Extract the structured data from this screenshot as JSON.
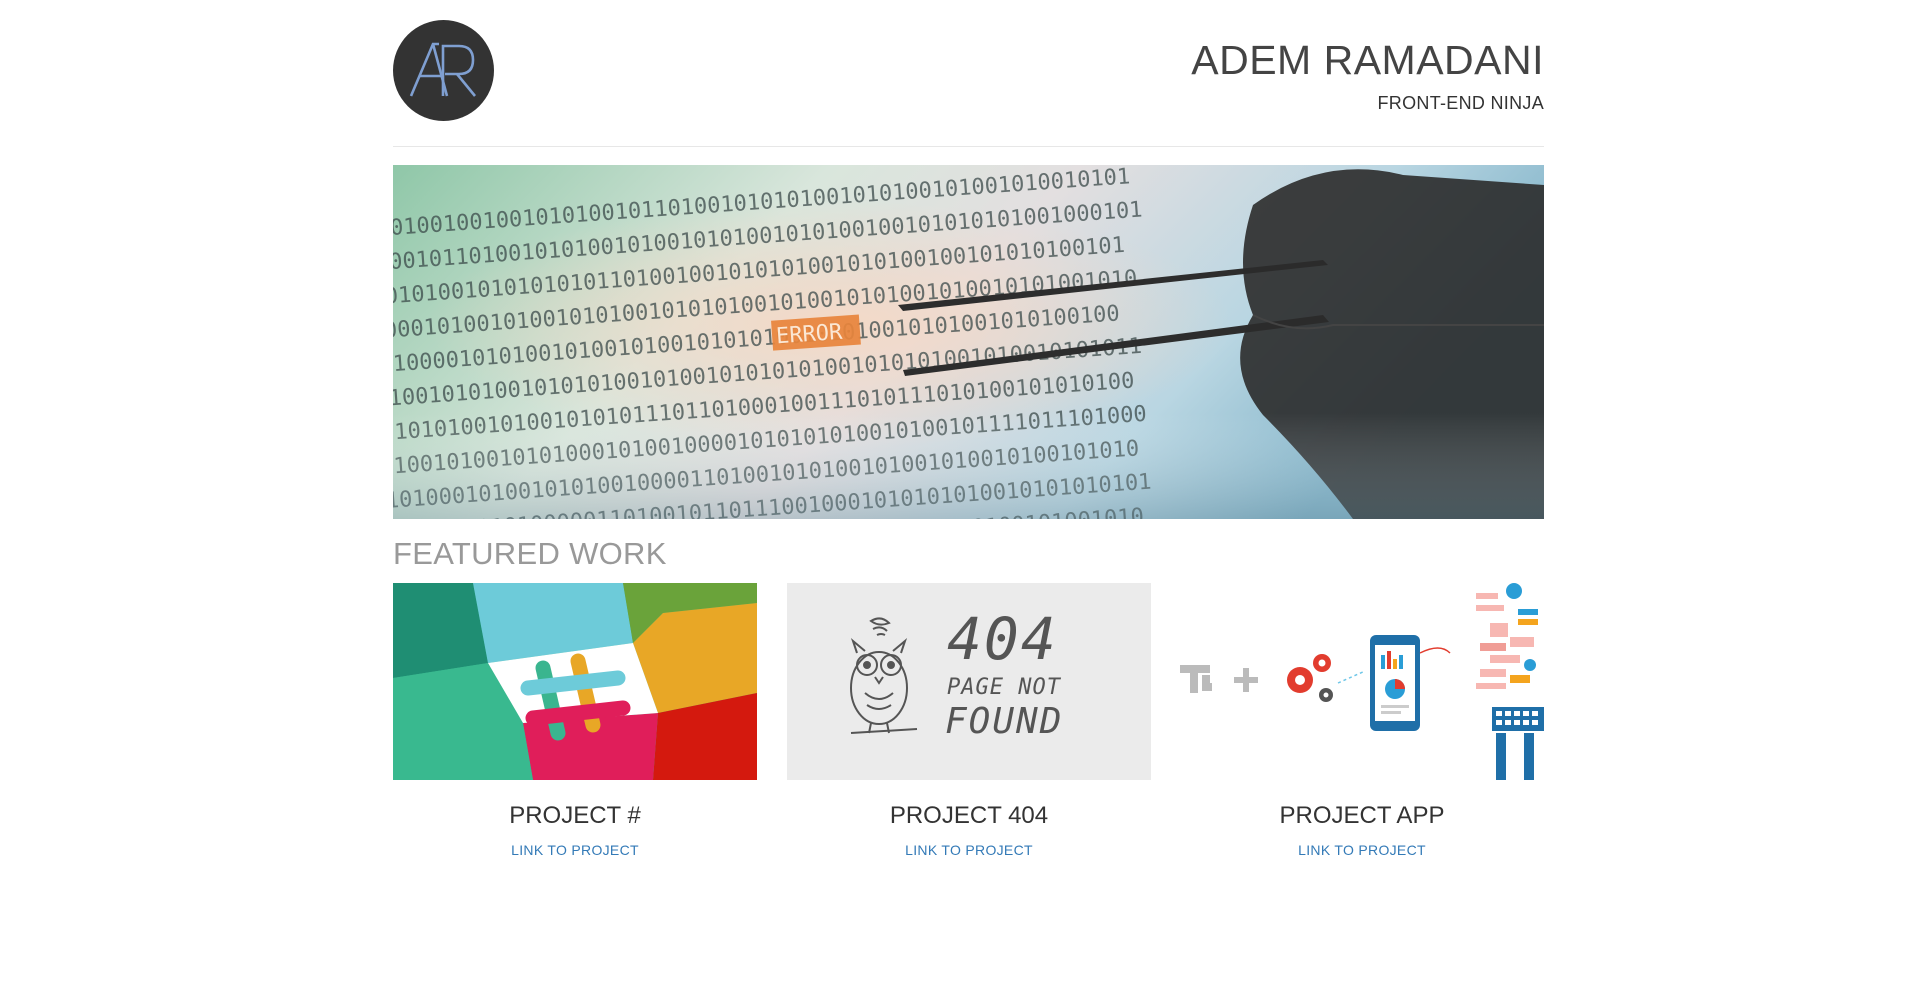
{
  "header": {
    "logo_text": "AR",
    "name": "ADEM RAMADANI",
    "tagline": "FRONT-END NINJA"
  },
  "hero": {
    "image": "binary-code-error-tweezers",
    "highlight_text": "ERROR"
  },
  "featured": {
    "title": "FEATURED WORK",
    "projects": [
      {
        "title": "PROJECT #",
        "link_label": "LINK TO PROJECT",
        "thumbnail": "slack-hash-logo"
      },
      {
        "title": "PROJECT 404",
        "link_label": "LINK TO PROJECT",
        "thumbnail": "owl-404-sketch",
        "thumb_text": [
          "404",
          "PAGE NOT",
          "FOUND"
        ]
      },
      {
        "title": "PROJECT APP",
        "link_label": "LINK TO PROJECT",
        "thumbnail": "app-infographic"
      }
    ]
  },
  "colors": {
    "link": "#337ab7",
    "heading_muted": "#999999",
    "logo_bg": "#333333",
    "logo_letter": "#7f9fd1"
  }
}
